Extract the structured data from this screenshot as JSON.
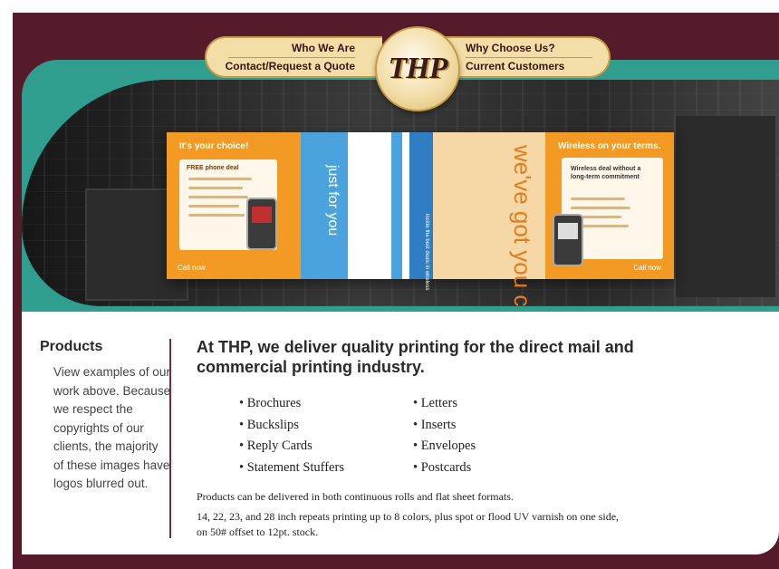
{
  "nav": {
    "left": [
      "Who We Are",
      "Contact/Request a Quote"
    ],
    "right": [
      "Why Choose Us?",
      "Current Customers"
    ],
    "logo": "THP"
  },
  "hero": {
    "panel1_title": "It's your choice!",
    "panel1_subtitle": "FREE phone deal",
    "panel1_footer": "Call now",
    "panel2_vertical": "just for you",
    "panel3_vertical": "we've got you covered",
    "panel3_tab": "inside the best deals in wireless",
    "panel4_title": "Wireless on your terms.",
    "panel4_subtitle": "Wireless deal without a long-term commitment",
    "panel4_footer": "Call now"
  },
  "sidebar": {
    "title": "Products",
    "text": "View examples of our work above. Because we respect the copyrights of our clients, the majority of these images have logos blurred out."
  },
  "main": {
    "headline": "At THP, we deliver quality printing for the direct mail and commercial printing industry.",
    "list_left": [
      "Brochures",
      "Buckslips",
      "Reply Cards",
      "Statement Stuffers"
    ],
    "list_right": [
      "Letters",
      "Inserts",
      "Envelopes",
      "Postcards"
    ],
    "para1": "Products can be delivered in both continuous rolls and flat sheet formats.",
    "para2": "14, 22, 23, and 28 inch repeats printing up to 8 colors, plus spot or flood UV varnish on one side, on 50# offset to 12pt. stock."
  },
  "colors": {
    "frame": "#561b2b",
    "teal": "#2f9e8e",
    "gold": "#f3dea8"
  }
}
